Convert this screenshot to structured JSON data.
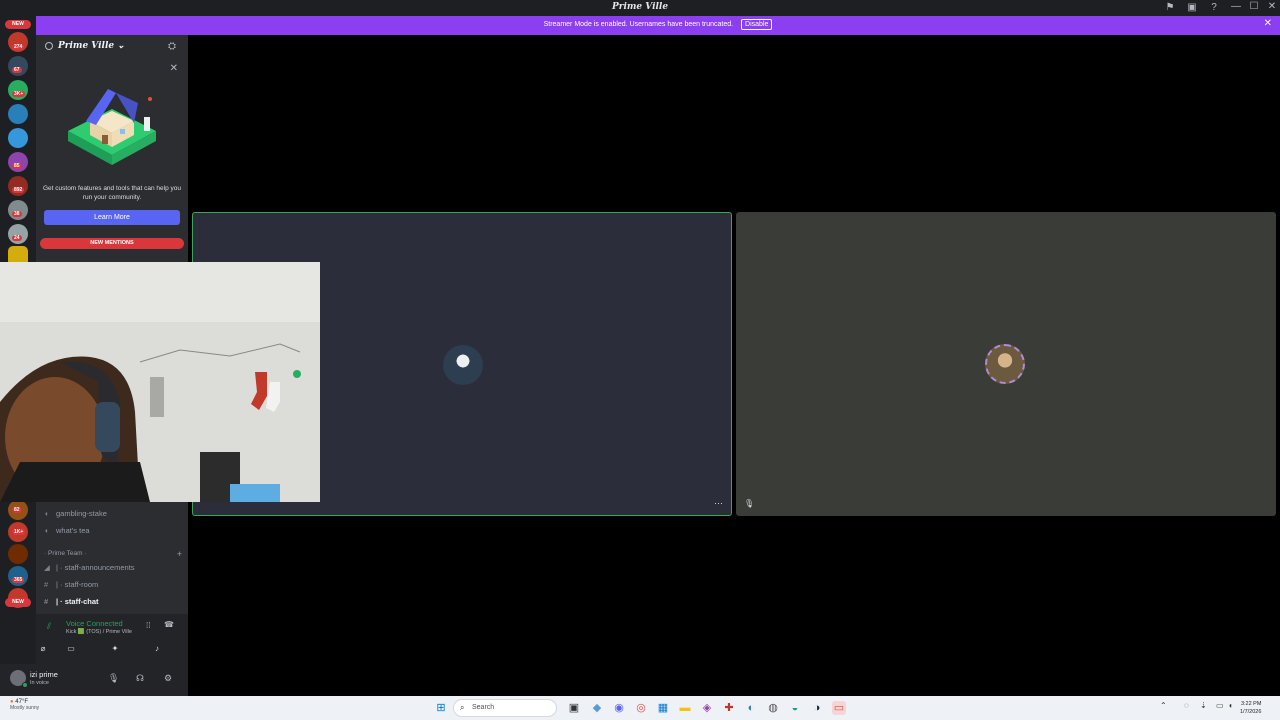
{
  "window": {
    "title": "Prime Ville",
    "controls": [
      "—",
      "☐",
      "✕"
    ]
  },
  "banner": {
    "text": "Streamer Mode is enabled. Usernames have been truncated.",
    "disable_label": "Disable",
    "close": "✕"
  },
  "server_rail": {
    "new_label": "NEW",
    "badges": [
      "274",
      "67",
      "3K+",
      "85",
      "892",
      "38",
      "24",
      "82",
      "1K+",
      "365"
    ],
    "new_bottom_label": "NEW"
  },
  "guild": {
    "name": "Prime Ville",
    "chevron": "⌄"
  },
  "promo": {
    "text": "Get custom features and tools that can help you run your community.",
    "button": "Learn More"
  },
  "new_mentions": "NEW MENTIONS",
  "channels": {
    "visible": [
      "gambling-stake",
      "what's tea"
    ],
    "category": "Prime Team",
    "team": [
      "staff-announcements",
      "staff-room",
      "staff-chat"
    ]
  },
  "voice": {
    "title": "Voice Connected",
    "sub": "Kick 🟩 (TOS) / Prime Ville"
  },
  "user": {
    "name": "izi prime",
    "status": "In voice"
  },
  "taskbar": {
    "temperature": "47°F",
    "condition": "Mostly sunny",
    "search_placeholder": "Search",
    "time": "3:22 PM",
    "date": "1/7/2026"
  },
  "colors": {
    "banner": "#8c3ff0",
    "accent": "#5865f2",
    "danger": "#da373c",
    "speaking": "#3ba55d"
  }
}
